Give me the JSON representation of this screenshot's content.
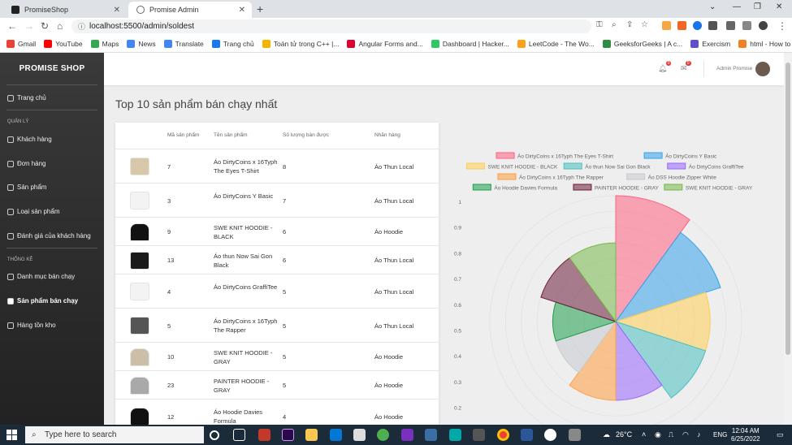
{
  "browser": {
    "tabs": [
      {
        "title": "PromiseShop",
        "active": false
      },
      {
        "title": "Promise Admin",
        "active": true
      }
    ],
    "url": "localhost:5500/admin/soldest",
    "bookmarks": [
      {
        "label": "Gmail",
        "color": "#ea4335"
      },
      {
        "label": "YouTube",
        "color": "#ff0000"
      },
      {
        "label": "Maps",
        "color": "#34a853"
      },
      {
        "label": "News",
        "color": "#4285f4"
      },
      {
        "label": "Translate",
        "color": "#4285f4"
      },
      {
        "label": "Trang chủ",
        "color": "#1877f2"
      },
      {
        "label": "Toán tử trong C++ |...",
        "color": "#f4b400"
      },
      {
        "label": "Angular Forms and...",
        "color": "#dd0031"
      },
      {
        "label": "Dashboard | Hacker...",
        "color": "#2ec866"
      },
      {
        "label": "LeetCode - The Wo...",
        "color": "#ffa116"
      },
      {
        "label": "GeeksforGeeks | A c...",
        "color": "#2f8d46"
      },
      {
        "label": "Exercism",
        "color": "#604fcd"
      },
      {
        "label": "html - How to use r...",
        "color": "#f48024"
      }
    ]
  },
  "sidebar": {
    "brand": "PROMISE SHOP",
    "home": "Trang chủ",
    "section_manage": "QUẢN LÝ",
    "manage_items": [
      "Khách hàng",
      "Đơn hàng",
      "Sản phẩm",
      "Loại sản phẩm",
      "Đánh giá của khách hàng"
    ],
    "section_stats": "THỐNG KÊ",
    "stats_items": [
      "Danh mục bán chạy",
      "Sản phẩm bán chạy",
      "Hàng tồn kho"
    ]
  },
  "topnav": {
    "bell_count": "0",
    "mail_count": "0",
    "admin_name": "Admin Promise"
  },
  "page": {
    "title": "Top 10 sản phẩm bán chạy nhất",
    "columns": [
      "Mã sản phẩm",
      "Tên sản phẩm",
      "Số lượng bán được",
      "Nhãn hàng"
    ],
    "rows": [
      {
        "id": "7",
        "name": "Áo DirtyCoins x 16Typh The Eyes T-Shirt",
        "qty": "8",
        "brand": "Áo Thun Local",
        "thumb": "tee-beige"
      },
      {
        "id": "3",
        "name": "Áo DirtyCoins Y Basic",
        "qty": "7",
        "brand": "Áo Thun Local",
        "thumb": "tee-white"
      },
      {
        "id": "9",
        "name": "SWE KNIT HOODIE - BLACK",
        "qty": "6",
        "brand": "Áo Hoodie",
        "thumb": "hoodie-black"
      },
      {
        "id": "13",
        "name": "Áo thun Now Sai Gon Black",
        "qty": "6",
        "brand": "Áo Thun Local",
        "thumb": "tee-black"
      },
      {
        "id": "4",
        "name": "Áo DirtyCoins GraffiTee",
        "qty": "5",
        "brand": "Áo Thun Local",
        "thumb": "tee-white"
      },
      {
        "id": "5",
        "name": "Áo DirtyCoins x 16Typh The Rapper",
        "qty": "5",
        "brand": "Áo Thun Local",
        "thumb": "tee-print"
      },
      {
        "id": "10",
        "name": "SWE KNIT HOODIE - GRAY",
        "qty": "5",
        "brand": "Áo Hoodie",
        "thumb": "hoodie-beige"
      },
      {
        "id": "23",
        "name": "PAINTER HOODIE - GRAY",
        "qty": "5",
        "brand": "Áo Hoodie",
        "thumb": "hoodie-gray"
      },
      {
        "id": "12",
        "name": "Áo Hoodie Davies Formula",
        "qty": "4",
        "brand": "Áo Hoodie",
        "thumb": "hoodie-black"
      }
    ]
  },
  "chart_data": {
    "type": "polarArea",
    "categories": [
      "Áo DirtyCoins x 16Typh The Eyes T-Shirt",
      "Áo DirtyCoins Y Basic",
      "SWE KNIT HOODIE - BLACK",
      "Áo thun Now Sai Gon Black",
      "Áo DirtyCoins GraffiTee",
      "Áo DirtyCoins x 16Typh The Rapper",
      "Áo DSS Hoodie Zipper White",
      "Áo Hoodie Davies Formula",
      "PAINTER HOODIE - GRAY",
      "SWE KNIT HOODIE - GRAY"
    ],
    "values": [
      8,
      7,
      6,
      6,
      5,
      5,
      4,
      4,
      5,
      5
    ],
    "colors": [
      "#ff6384",
      "#36a2eb",
      "#ffcd56",
      "#4bc0c0",
      "#9966ff",
      "#ff9f40",
      "#c9cbcf",
      "#1e9e4a",
      "#6b1e3a",
      "#78b84a"
    ],
    "tick_labels": [
      "1",
      "0.9",
      "0.8",
      "0.7",
      "0.6",
      "0.5",
      "0.4",
      "0.3",
      "0.2"
    ],
    "legend": "top"
  },
  "taskbar": {
    "search_placeholder": "Type here to search",
    "weather": "26°C",
    "language": "ENG",
    "time": "12:04 AM",
    "date": "6/25/2022"
  }
}
